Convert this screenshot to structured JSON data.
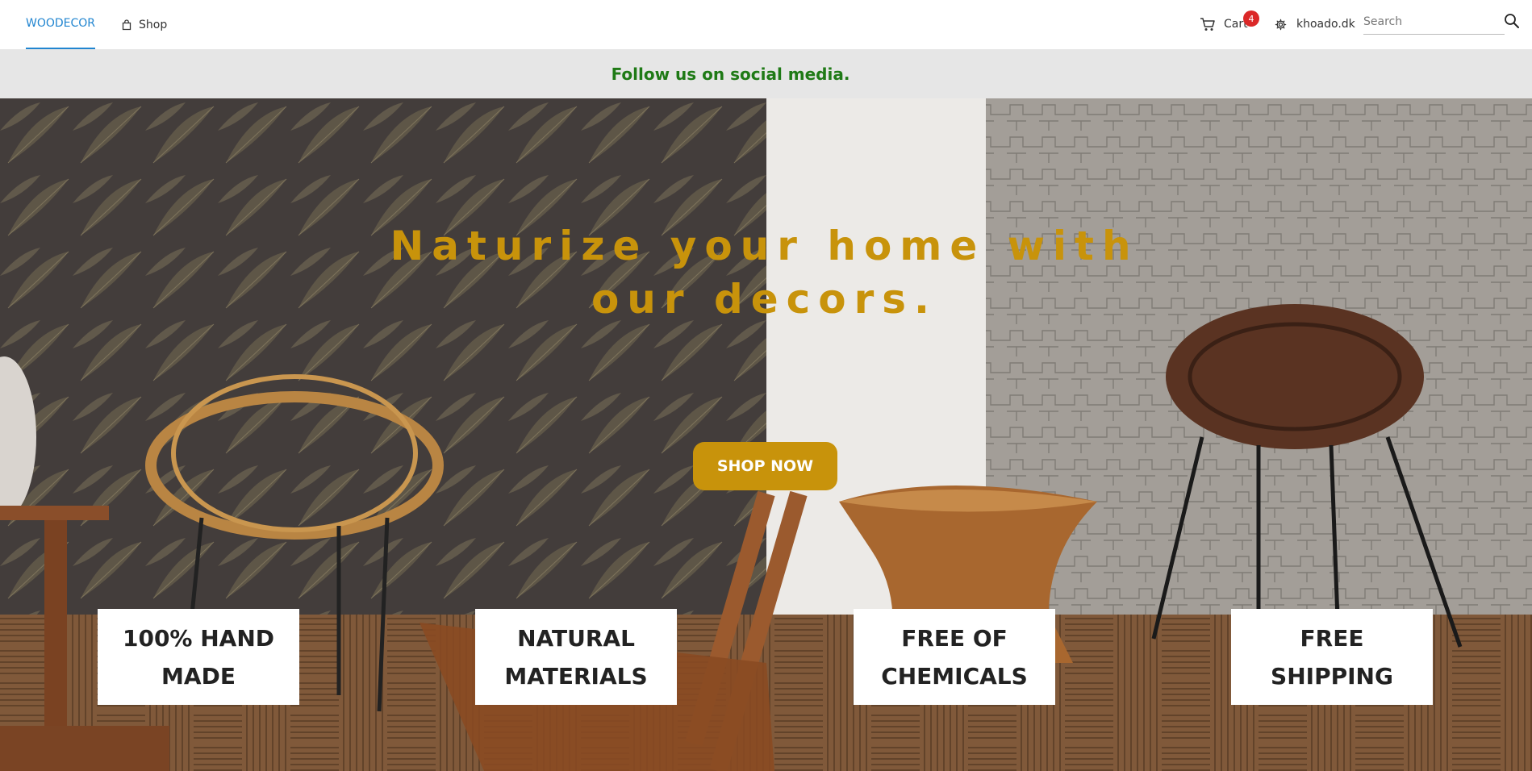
{
  "navbar": {
    "brand": "WOODECOR",
    "shop_label": "Shop",
    "cart_label": "Cart",
    "cart_count": "4",
    "account_label": "khoado.dk",
    "search_placeholder": "Search"
  },
  "announcement": {
    "text": "Follow us on social media."
  },
  "hero": {
    "title": "Naturize your home with our decors.",
    "cta_label": "SHOP NOW"
  },
  "features": [
    {
      "label": "100% HAND MADE"
    },
    {
      "label": "NATURAL MATERIALS"
    },
    {
      "label": "FREE OF CHEMICALS"
    },
    {
      "label": "FREE SHIPPING"
    }
  ],
  "colors": {
    "brand_active": "#2185d0",
    "announcement_text": "#1f7a16",
    "accent_gold": "#c8930b",
    "badge_red": "#db2828"
  },
  "icons": {
    "shop": "shopping-bag-icon",
    "cart": "cart-icon",
    "account": "gear-icon",
    "search": "search-icon"
  }
}
